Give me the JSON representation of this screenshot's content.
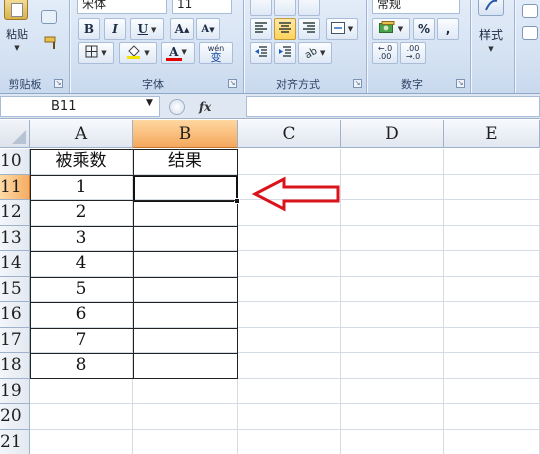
{
  "ribbon": {
    "clipboard": {
      "paste_label": "粘贴",
      "group_label": "剪贴板"
    },
    "font": {
      "font_name": "宋体",
      "font_size": "11",
      "bold": "B",
      "italic": "I",
      "underline": "U",
      "grow": "A",
      "shrink": "A",
      "font_color_letter": "A",
      "phonetic": "wén",
      "phonetic_char": "变",
      "group_label": "字体"
    },
    "alignment": {
      "group_label": "对齐方式"
    },
    "number": {
      "format": "常规",
      "percent": "%",
      "comma": ",",
      "inc_decimal": "←.0 .00",
      "dec_decimal": ".00 →.0",
      "group_label": "数字"
    },
    "styles": {
      "label": "样式"
    }
  },
  "formula_bar": {
    "name_box": "B11",
    "fx_label": "fx",
    "formula": ""
  },
  "sheet": {
    "columns": [
      "A",
      "B",
      "C",
      "D",
      "E"
    ],
    "rows": [
      "10",
      "11",
      "12",
      "13",
      "14",
      "15",
      "16",
      "17",
      "18",
      "19",
      "20",
      "21"
    ],
    "selected_column": "B",
    "selected_row": "11",
    "cells": {
      "A10": "被乘数",
      "B10": "结果",
      "A11": "1",
      "A12": "2",
      "A13": "3",
      "A14": "4",
      "A15": "5",
      "A16": "6",
      "A17": "7",
      "A18": "8"
    }
  },
  "annotation": {
    "arrow_color": "#d9141b"
  },
  "colors": {
    "ribbon_bg": "#d6e3f3",
    "selected_header": "#f5a85d",
    "grid_line": "#d6dce6"
  }
}
